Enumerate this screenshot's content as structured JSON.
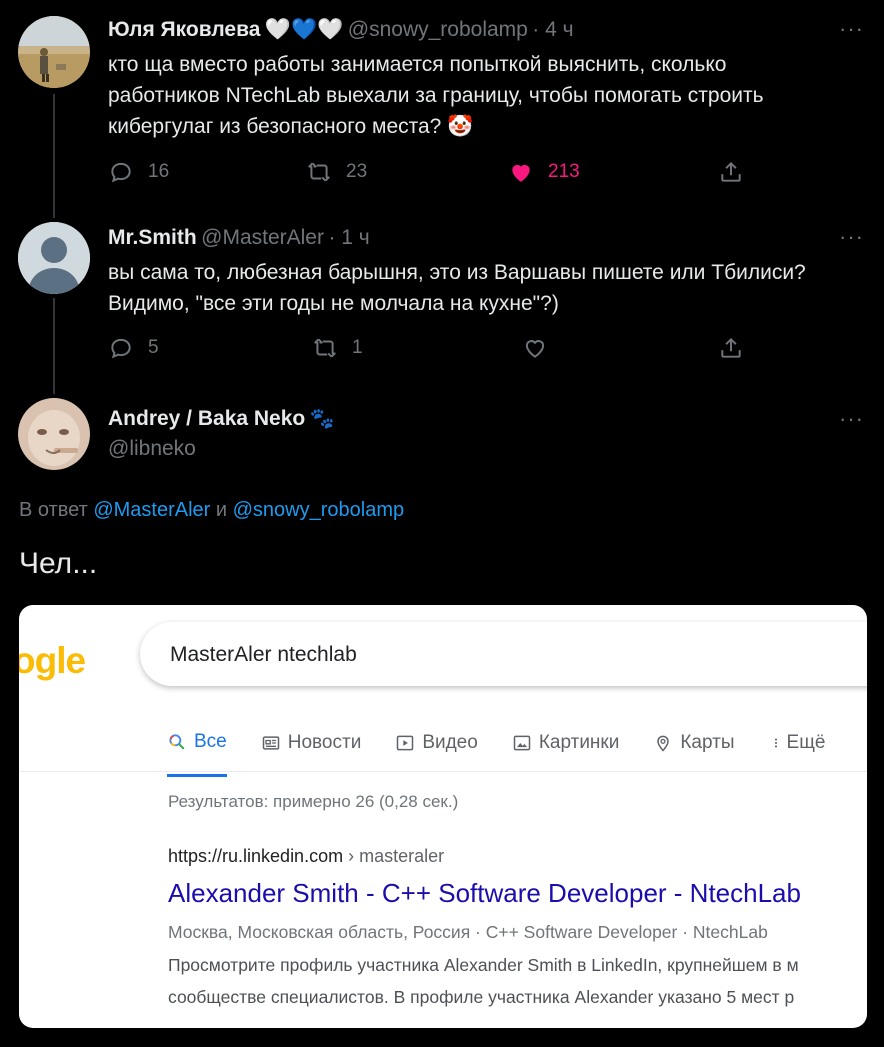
{
  "tweets": [
    {
      "name": "Юля Яковлева",
      "name_emoji": "🤍💙🤍",
      "handle": "@snowy_robolamp",
      "time": "· 4 ч",
      "lines": [
        "кто ща вместо работы занимается попыткой выяснить, сколько",
        "работников NTechLab выехали за границу, чтобы помогать строить",
        "кибергулаг из безопасного места? 🤡"
      ],
      "replies": "16",
      "retweets": "23",
      "likes": "213",
      "liked": true
    },
    {
      "name": "Mr.Smith",
      "handle": "@MasterAler",
      "time": "· 1 ч",
      "lines": [
        "вы сама то, любезная барышня, это из Варшавы пишете или Тбилиси?",
        "Видимо, \"все эти годы не молчала на кухне\"?)"
      ],
      "replies": "5",
      "retweets": "1",
      "likes": "",
      "liked": false
    },
    {
      "name": "Andrey / Baka Neko",
      "name_emoji": "🐾",
      "handle": "@libneko",
      "reply_prefix": "В ответ",
      "reply_to_1": "@MasterAler",
      "reply_and": "и",
      "reply_to_2": "@snowy_robolamp",
      "text": "Чел..."
    }
  ],
  "more_icon": "···",
  "google": {
    "logo_text": "ogle",
    "query": "MasterAler ntechlab",
    "tabs": [
      {
        "label": "Все",
        "icon": "search-icon",
        "active": true
      },
      {
        "label": "Новости",
        "icon": "news-icon",
        "active": false
      },
      {
        "label": "Видео",
        "icon": "video-icon",
        "active": false
      },
      {
        "label": "Картинки",
        "icon": "image-icon",
        "active": false
      },
      {
        "label": "Карты",
        "icon": "map-pin-icon",
        "active": false
      },
      {
        "label": "Ещё",
        "icon": "more-vert-icon",
        "active": false
      }
    ],
    "result_count": "Результатов: примерно 26 (0,28 сек.)",
    "result": {
      "url": "https://ru.linkedin.com",
      "breadcrumb": "› masteraler",
      "title": "Alexander Smith - C++ Software Developer - NtechLab",
      "meta": "Москва, Московская область, Россия · C++ Software Developer · NtechLab",
      "snippet_1": "Просмотрите профиль участника Alexander Smith в LinkedIn, крупнейшем в м",
      "snippet_2": "сообществе специалистов. В профиле участника Alexander указано 5 мест р"
    }
  },
  "colors": {
    "background": "#000000",
    "text": "#e7e9ea",
    "muted": "#71767b",
    "link": "#1d9bf0",
    "like": "#f91880",
    "google_link": "#1a0dab",
    "google_blue": "#1a73e8"
  }
}
